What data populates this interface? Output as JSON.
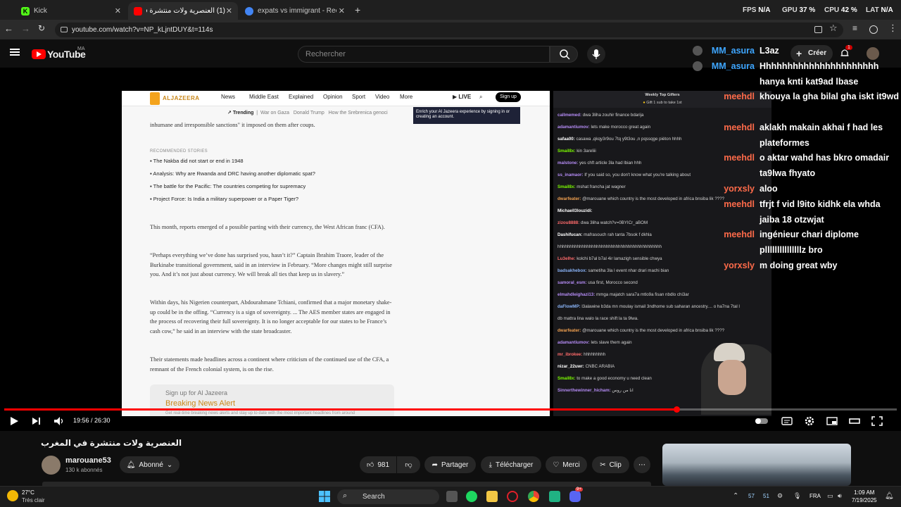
{
  "browser": {
    "tabs": [
      {
        "label": "Kick",
        "color": "#53fc18"
      },
      {
        "label": "(1) العنصرية ولات منتشرة في ال...",
        "color": "#ff0000"
      },
      {
        "label": "expats vs immigrant - Recherch",
        "color": "#4285f4"
      }
    ],
    "url": "youtube.com/watch?v=NP_kLjntDUY&t=114s",
    "perf": {
      "fps_label": "FPS",
      "fps_value": "N/A",
      "gpu_label": "GPU",
      "gpu_value": "37",
      "cpu_label": "CPU",
      "cpu_value": "42",
      "lat_label": "LAT",
      "lat_value": "N/A",
      "percent": "%"
    }
  },
  "youtube": {
    "logo": "YouTube",
    "region": "MA",
    "search_placeholder": "Rechercher",
    "create_label": "Créer",
    "notif_count": "1"
  },
  "article": {
    "brand": "ALJAZEERA",
    "nav": [
      "News",
      "Middle East",
      "Explained",
      "Opinion",
      "Sport",
      "Video",
      "More"
    ],
    "live": "LIVE",
    "signup": "Sign up",
    "trending_label": "Trending",
    "trending": [
      "War on Gaza",
      "Donald Trump",
      "How the Srebrenica genoci"
    ],
    "tooltip": "Enrich your Al Jazeera experience by signing in or creating an account.",
    "lead": "inhumane and irresponsible sanctions\" it imposed on them after coups.",
    "rec_head": "RECOMMENDED STORIES",
    "rec": [
      "The Nakba did not start or end in 1948",
      "Analysis: Why are Rwanda and DRC having another diplomatic spat?",
      "The battle for the Pacific: The countries competing for supremacy",
      "Project Force: Is India a military superpower or a Paper Tiger?"
    ],
    "p1": "This month, reports emerged of a possible parting with their currency, the West African franc (CFA).",
    "p2": "“Perhaps everything we’ve done has surprised you, hasn’t it?” Captain Ibrahim Traore, leader of the Burkinabe transitional government, said in an interview in February. “More changes might still surprise you. And it’s not just about currency. We will break all ties that keep us in slavery.”",
    "p3": "Within days, his Nigerien counterpart, Abdourahmane Tchiani, confirmed that a major monetary shake-up could be in the offing. “Currency is a sign of sovereignty. ... The AES member states are engaged in the process of recovering their full sovereignty. It is no longer acceptable for our states to be France’s cash cow,” he said in an interview with the state broadcaster.",
    "p4": "Their statements made headlines across a continent where criticism of the continued use of the CFA, a remnant of the French colonial system, is on the rise.",
    "alert_small": "Sign up for Al Jazeera",
    "alert_big": "Breaking News Alert",
    "alert_sub": "Get real-time breaking news alerts and stay up to date with the most important headlines from around"
  },
  "stream_chat": {
    "header": "Weekly Top Gifters",
    "gift": "Gift 1 sub to take 1st",
    "lines": [
      {
        "user": "callmemed:",
        "msg": "dwa 3liha zouhir finance bdarija",
        "color": "#b58cf5"
      },
      {
        "user": "adamantiumov:",
        "msg": "lets make morocco great again",
        "color": "#b58cf5"
      },
      {
        "user": "safaa00:",
        "msg": "casawa ,qkqy3r9ou 7tq y9t3ou ,n pqssqge piéton hhhh",
        "color": "#ffffff"
      },
      {
        "user": "Smail8x:",
        "msg": "kin 3areliii",
        "color": "#7cfc00"
      },
      {
        "user": "malstone:",
        "msg": "yes chft article 3la had lbian hhh",
        "color": "#b58cf5"
      },
      {
        "user": "ss_inamaor:",
        "msg": "If you said so, you don't know what you're talking about",
        "color": "#b58cf5"
      },
      {
        "user": "Smail8x:",
        "msg": "mshat francha jat wagner",
        "color": "#7cfc00"
      },
      {
        "user": "dwarfeater:",
        "msg": "@marouane which country is the most developed in africa bnsiba lik ????",
        "color": "#f0a050"
      },
      {
        "user": "Michaell3louzidi:",
        "msg": "",
        "color": "#ffffff"
      },
      {
        "user": "zizou8888:",
        "msg": "dwa 3liha watch?v=0BYICr_aBOM",
        "color": "#ff6b6b"
      },
      {
        "user": "Dashifucan:",
        "msg": "mafrasouch rah tanta 7bsok f dkhla",
        "color": "#ffffff"
      },
      {
        "user": "",
        "msg": "hhhhhhhhhhhhhhhhhhhhhhhhhhhhhhhhhhhhhhhhhhh",
        "color": "#ffffff"
      },
      {
        "user": "Lu3elhe:",
        "msg": "kolchi b7al b7al 4ir lamazigh sensible chwya",
        "color": "#ff6b6b"
      },
      {
        "user": "badsakhebox:",
        "msg": "sametiha 3la l event nhar drari machi bian",
        "color": "#8ab4f8"
      },
      {
        "user": "samoral_esm:",
        "msg": "usa first, Morocco second",
        "color": "#b58cf5"
      },
      {
        "user": "elmahdleighazi13:",
        "msg": "mmga majatch sara7a mtlo9a fisan nbdlo chi3ar",
        "color": "#b58cf5"
      },
      {
        "user": "daFlowMP:",
        "msg": "l3alawine b3da mn moulay ismail 3ndhome sub saharan ancestry.... o ha7na 7tal l",
        "color": "#8ab4f8"
      },
      {
        "user": "",
        "msg": "db mattra lina walo la race shift la ta 9lwa.",
        "color": "#ffffff"
      },
      {
        "user": "dwarfeater:",
        "msg": "@marouane which country is the most developed in africa bnsiba lik ????",
        "color": "#f0a050"
      },
      {
        "user": "adamantiumov:",
        "msg": "lets slave them again",
        "color": "#b58cf5"
      },
      {
        "user": "mr_ibrokee:",
        "msg": "hhhhhhhhh",
        "color": "#ff6b6b"
      },
      {
        "user": "nizar_22uwr:",
        "msg": "CNBC ARABIA",
        "color": "#ffffff"
      },
      {
        "user": "Smail8x:",
        "msg": "to make a good economy u need clean",
        "color": "#7cfc00"
      },
      {
        "user": "Sinnerthewinner_hicham:",
        "msg": "انا من روس",
        "color": "#b58cf5"
      }
    ]
  },
  "player": {
    "time": "19:56 / 26:30",
    "progress_fraction": 0.7529
  },
  "live_chat": [
    {
      "name": "MM_asura",
      "color": "#3ea6ff",
      "msg": "L3az",
      "badge": true
    },
    {
      "name": "MM_asura",
      "color": "#3ea6ff",
      "msg": "Hhhhhhhhhhhhhhhhhhhhhh hanya knti kat9ad lbase",
      "badge": true
    },
    {
      "name": "meehdl",
      "color": "#ff6b4a",
      "msg": "khouya la gha bilal gha iskt it9wd",
      "badge": false
    },
    {
      "name": "meehdl",
      "color": "#ff6b4a",
      "msg": "aklakh makain akhai f had les plateformes",
      "badge": false
    },
    {
      "name": "meehdl",
      "color": "#ff6b4a",
      "msg": "o aktar wahd has bkro omadair ta9lwa fhyato",
      "badge": false
    },
    {
      "name": "yorxsly",
      "color": "#ff6b4a",
      "msg": "aloo",
      "badge": false
    },
    {
      "name": "meehdl",
      "color": "#ff6b4a",
      "msg": "tfrjt f vid l9ito kidhk ela whda jaiba 18 otzwjat",
      "badge": false
    },
    {
      "name": "meehdl",
      "color": "#ff6b4a",
      "msg": "ingénieur chari diplome plllllllllllllllz bro",
      "badge": false
    },
    {
      "name": "yorxsly",
      "color": "#ff6b4a",
      "msg": "m doing great wby",
      "badge": false
    }
  ],
  "video_info": {
    "title": "العنصرية ولات منتشرة في المغرب",
    "channel": "marouane53",
    "subs": "130 k abonnés",
    "subscribed": "Abonné",
    "likes": "981",
    "share": "Partager",
    "download": "Télécharger",
    "thanks": "Merci",
    "clip": "Clip"
  },
  "taskbar": {
    "weather_temp": "27°C",
    "weather_desc": "Très clair",
    "search": "Search",
    "tray_num1": "57",
    "tray_num2": "51",
    "lang": "FRA",
    "time": "1:09 AM",
    "date": "7/19/2025",
    "discord_badge": "9+"
  }
}
